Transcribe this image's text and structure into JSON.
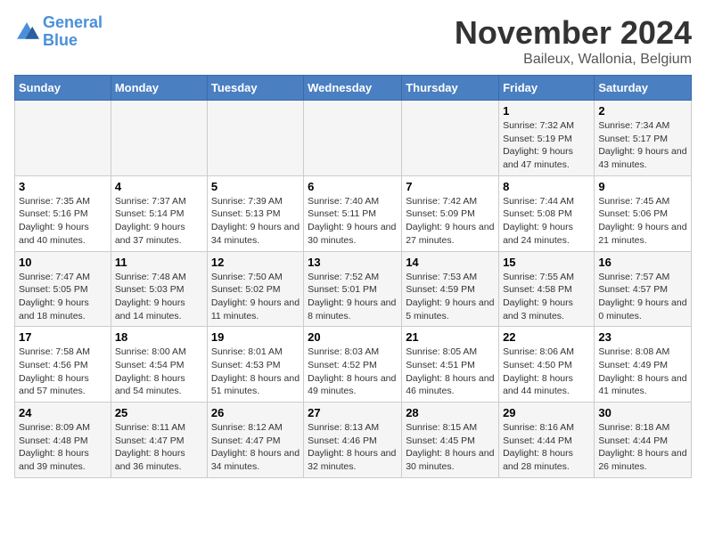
{
  "logo": {
    "line1": "General",
    "line2": "Blue"
  },
  "title": "November 2024",
  "location": "Baileux, Wallonia, Belgium",
  "days_of_week": [
    "Sunday",
    "Monday",
    "Tuesday",
    "Wednesday",
    "Thursday",
    "Friday",
    "Saturday"
  ],
  "weeks": [
    [
      {
        "day": "",
        "info": ""
      },
      {
        "day": "",
        "info": ""
      },
      {
        "day": "",
        "info": ""
      },
      {
        "day": "",
        "info": ""
      },
      {
        "day": "",
        "info": ""
      },
      {
        "day": "1",
        "info": "Sunrise: 7:32 AM\nSunset: 5:19 PM\nDaylight: 9 hours and 47 minutes."
      },
      {
        "day": "2",
        "info": "Sunrise: 7:34 AM\nSunset: 5:17 PM\nDaylight: 9 hours and 43 minutes."
      }
    ],
    [
      {
        "day": "3",
        "info": "Sunrise: 7:35 AM\nSunset: 5:16 PM\nDaylight: 9 hours and 40 minutes."
      },
      {
        "day": "4",
        "info": "Sunrise: 7:37 AM\nSunset: 5:14 PM\nDaylight: 9 hours and 37 minutes."
      },
      {
        "day": "5",
        "info": "Sunrise: 7:39 AM\nSunset: 5:13 PM\nDaylight: 9 hours and 34 minutes."
      },
      {
        "day": "6",
        "info": "Sunrise: 7:40 AM\nSunset: 5:11 PM\nDaylight: 9 hours and 30 minutes."
      },
      {
        "day": "7",
        "info": "Sunrise: 7:42 AM\nSunset: 5:09 PM\nDaylight: 9 hours and 27 minutes."
      },
      {
        "day": "8",
        "info": "Sunrise: 7:44 AM\nSunset: 5:08 PM\nDaylight: 9 hours and 24 minutes."
      },
      {
        "day": "9",
        "info": "Sunrise: 7:45 AM\nSunset: 5:06 PM\nDaylight: 9 hours and 21 minutes."
      }
    ],
    [
      {
        "day": "10",
        "info": "Sunrise: 7:47 AM\nSunset: 5:05 PM\nDaylight: 9 hours and 18 minutes."
      },
      {
        "day": "11",
        "info": "Sunrise: 7:48 AM\nSunset: 5:03 PM\nDaylight: 9 hours and 14 minutes."
      },
      {
        "day": "12",
        "info": "Sunrise: 7:50 AM\nSunset: 5:02 PM\nDaylight: 9 hours and 11 minutes."
      },
      {
        "day": "13",
        "info": "Sunrise: 7:52 AM\nSunset: 5:01 PM\nDaylight: 9 hours and 8 minutes."
      },
      {
        "day": "14",
        "info": "Sunrise: 7:53 AM\nSunset: 4:59 PM\nDaylight: 9 hours and 5 minutes."
      },
      {
        "day": "15",
        "info": "Sunrise: 7:55 AM\nSunset: 4:58 PM\nDaylight: 9 hours and 3 minutes."
      },
      {
        "day": "16",
        "info": "Sunrise: 7:57 AM\nSunset: 4:57 PM\nDaylight: 9 hours and 0 minutes."
      }
    ],
    [
      {
        "day": "17",
        "info": "Sunrise: 7:58 AM\nSunset: 4:56 PM\nDaylight: 8 hours and 57 minutes."
      },
      {
        "day": "18",
        "info": "Sunrise: 8:00 AM\nSunset: 4:54 PM\nDaylight: 8 hours and 54 minutes."
      },
      {
        "day": "19",
        "info": "Sunrise: 8:01 AM\nSunset: 4:53 PM\nDaylight: 8 hours and 51 minutes."
      },
      {
        "day": "20",
        "info": "Sunrise: 8:03 AM\nSunset: 4:52 PM\nDaylight: 8 hours and 49 minutes."
      },
      {
        "day": "21",
        "info": "Sunrise: 8:05 AM\nSunset: 4:51 PM\nDaylight: 8 hours and 46 minutes."
      },
      {
        "day": "22",
        "info": "Sunrise: 8:06 AM\nSunset: 4:50 PM\nDaylight: 8 hours and 44 minutes."
      },
      {
        "day": "23",
        "info": "Sunrise: 8:08 AM\nSunset: 4:49 PM\nDaylight: 8 hours and 41 minutes."
      }
    ],
    [
      {
        "day": "24",
        "info": "Sunrise: 8:09 AM\nSunset: 4:48 PM\nDaylight: 8 hours and 39 minutes."
      },
      {
        "day": "25",
        "info": "Sunrise: 8:11 AM\nSunset: 4:47 PM\nDaylight: 8 hours and 36 minutes."
      },
      {
        "day": "26",
        "info": "Sunrise: 8:12 AM\nSunset: 4:47 PM\nDaylight: 8 hours and 34 minutes."
      },
      {
        "day": "27",
        "info": "Sunrise: 8:13 AM\nSunset: 4:46 PM\nDaylight: 8 hours and 32 minutes."
      },
      {
        "day": "28",
        "info": "Sunrise: 8:15 AM\nSunset: 4:45 PM\nDaylight: 8 hours and 30 minutes."
      },
      {
        "day": "29",
        "info": "Sunrise: 8:16 AM\nSunset: 4:44 PM\nDaylight: 8 hours and 28 minutes."
      },
      {
        "day": "30",
        "info": "Sunrise: 8:18 AM\nSunset: 4:44 PM\nDaylight: 8 hours and 26 minutes."
      }
    ]
  ]
}
